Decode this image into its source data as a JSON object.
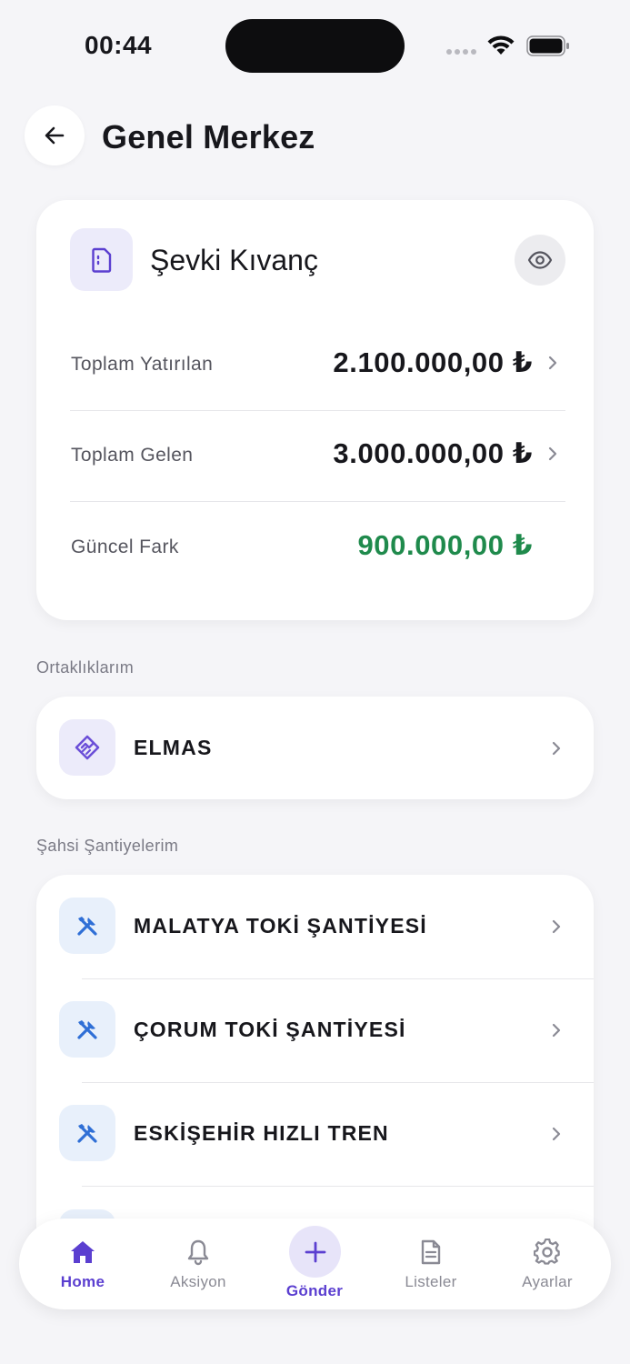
{
  "status_bar": {
    "time": "00:44"
  },
  "header": {
    "title": "Genel Merkez"
  },
  "summary": {
    "name": "Şevki Kıvanç",
    "rows": [
      {
        "label": "Toplam Yatırılan",
        "value": "2.100.000,00 ₺"
      },
      {
        "label": "Toplam Gelen",
        "value": "3.000.000,00 ₺"
      },
      {
        "label": "Güncel Fark",
        "value": "900.000,00 ₺"
      }
    ]
  },
  "partnerships": {
    "title": "Ortaklıklarım",
    "items": [
      {
        "label": "ELMAS"
      }
    ]
  },
  "sites": {
    "title": "Şahsi Şantiyelerim",
    "items": [
      {
        "label": "MALATYA TOKİ ŞANTİYESİ"
      },
      {
        "label": "ÇORUM TOKİ ŞANTİYESİ"
      },
      {
        "label": "ESKİŞEHİR HIZLI TREN"
      }
    ]
  },
  "nav": {
    "items": [
      {
        "label": "Home",
        "icon": "home-icon"
      },
      {
        "label": "Aksiyon",
        "icon": "bell-icon"
      },
      {
        "label": "Gönder",
        "icon": "plus-icon"
      },
      {
        "label": "Listeler",
        "icon": "document-icon"
      },
      {
        "label": "Ayarlar",
        "icon": "gear-icon"
      }
    ],
    "active_color": "#5b3fd0"
  },
  "colors": {
    "accent": "#5b3fd0",
    "positive": "#1f8a4c",
    "site_icon": "#2f6fd6"
  }
}
